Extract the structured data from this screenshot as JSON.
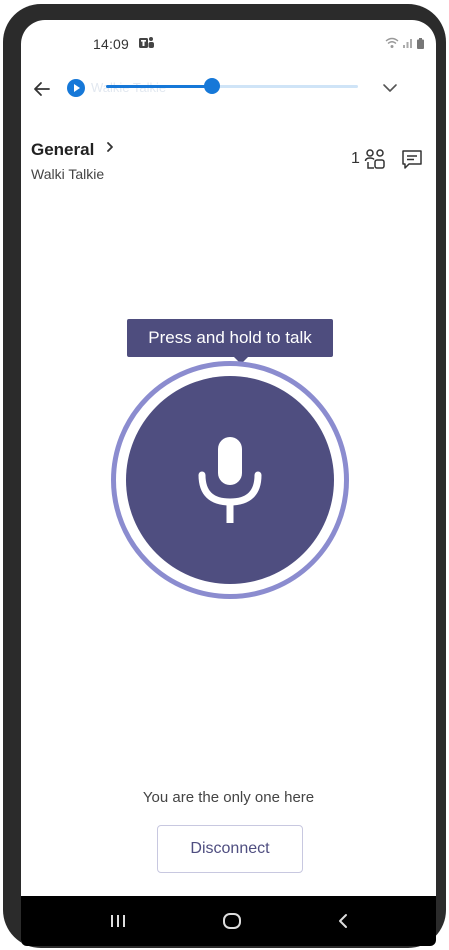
{
  "status_bar": {
    "time": "14:09"
  },
  "header": {
    "ghost_title": "Walkie Talkie",
    "audio_progress": 0.42
  },
  "channel": {
    "name": "General",
    "subtitle": "Walki Talkie",
    "participant_count": "1"
  },
  "talk": {
    "tooltip": "Press and hold to talk"
  },
  "footer": {
    "status_text": "You are the only one here",
    "disconnect_label": "Disconnect"
  },
  "colors": {
    "accent": "#4f4e80",
    "ring": "#8b8ccf",
    "progress_blue": "#1678d8"
  },
  "icons": {
    "back": "arrow-left-icon",
    "play": "play-icon",
    "expand": "chevron-down-icon",
    "people": "people-icon",
    "chat": "chat-icon",
    "mic": "microphone-icon"
  }
}
